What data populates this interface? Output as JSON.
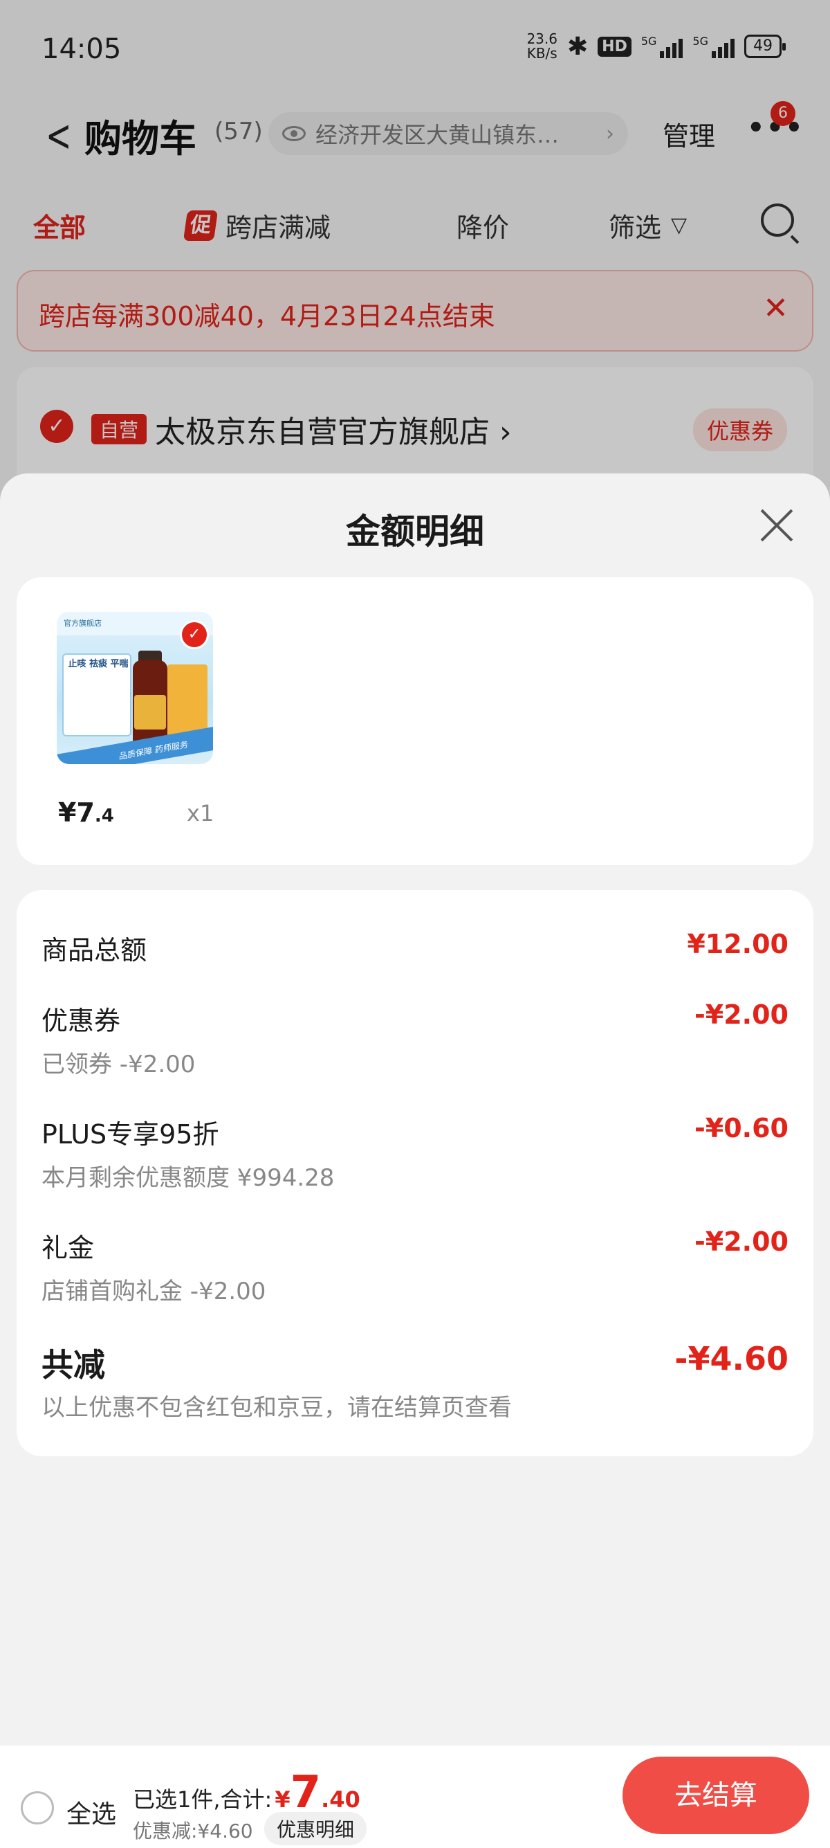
{
  "status_bar": {
    "time": "14:05",
    "net_speed_value": "23.6",
    "net_speed_unit": "KB/s",
    "hd_label": "HD",
    "sig1_label": "5G",
    "sig2_label": "5G",
    "battery": "49"
  },
  "nav": {
    "back_icon": "chevron-left-icon",
    "title": "购物车",
    "count": "(57)",
    "address": "经济开发区大黄山镇东…",
    "manage": "管理",
    "more_badge": "6"
  },
  "filter_tabs": {
    "all": "全部",
    "promo_badge": "促",
    "cross_store": "跨店满减",
    "price_drop": "降价",
    "filter": "筛选"
  },
  "banner": {
    "text": "跨店每满300减40，4月23日24点结束"
  },
  "shop": {
    "self_badge": "自营",
    "name": "太极京东自营官方旗舰店",
    "coupon": "优惠券"
  },
  "sheet": {
    "title": "金额明细",
    "product": {
      "price_int": "¥7",
      "price_dec": ".4",
      "qty": "x1",
      "image_texts": {
        "store": "官方旗舰店",
        "box_title": "止咳 祛痰 平喘",
        "strip": "品质保障 药师服务"
      }
    },
    "rows": [
      {
        "label": "商品总额",
        "value": "¥12.00",
        "sub": ""
      },
      {
        "label": "优惠券",
        "value": "-¥2.00",
        "sub": "已领券 -¥2.00"
      },
      {
        "label": "PLUS专享95折",
        "value": "-¥0.60",
        "sub": "本月剩余优惠额度 ¥994.28"
      },
      {
        "label": "礼金",
        "value": "-¥2.00",
        "sub": "店铺首购礼金 -¥2.00"
      }
    ],
    "total": {
      "label": "共减",
      "value": "-¥4.60",
      "note": "以上优惠不包含红包和京豆，请在结算页查看"
    }
  },
  "bottom_bar": {
    "select_all": "全选",
    "summary_prefix": "已选1件,合计:",
    "currency": "¥",
    "total_int": "7",
    "total_dec": ".40",
    "discount": "优惠减:¥4.60",
    "detail_button": "优惠明细",
    "checkout": "去结算"
  },
  "colors": {
    "accent": "#e2231a",
    "checkout": "#f04d46"
  }
}
